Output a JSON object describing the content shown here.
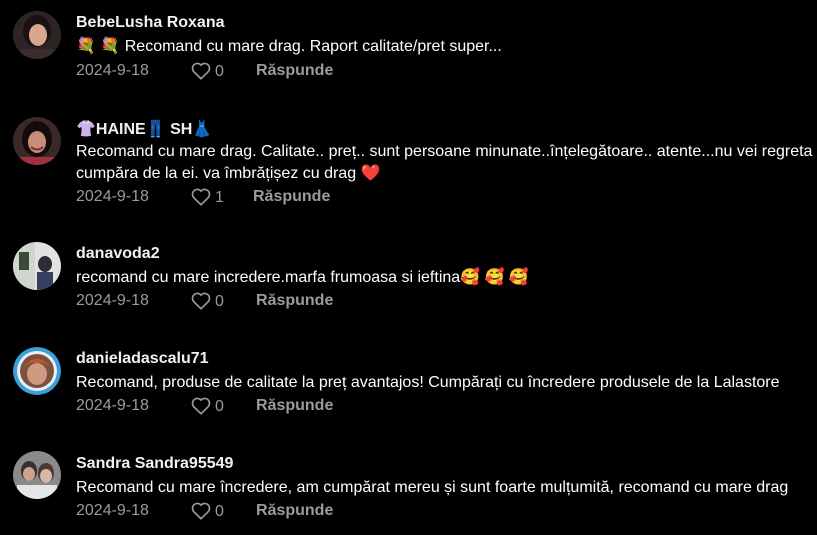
{
  "comments": [
    {
      "username": "BebeLusha Roxana",
      "text": "💐 💐 Recomand cu mare drag. Raport calitate/pret super...",
      "text2": "",
      "date": "2024-9-18",
      "likes": "0",
      "reply_label": "Răspunde",
      "avatar_colors": [
        "#3a2a2a",
        "#d9a58c"
      ]
    },
    {
      "username": "👚HAINE👖 SH👗",
      "text": "Recomand cu mare drag. Calitate.. preț.. sunt persoane minunate..înțelegătoare.. atente...nu vei regreta daca",
      "text2": "cumpăra de la ei. va îmbrățișez cu drag ❤️",
      "date": "2024-9-18",
      "likes": "1",
      "reply_label": "Răspunde",
      "avatar_colors": [
        "#2a1c1c",
        "#b88473"
      ]
    },
    {
      "username": "danavoda2",
      "text": "recomand cu mare incredere.marfa frumoasa si ieftina🥰 🥰 🥰",
      "text2": "",
      "date": "2024-9-18",
      "likes": "0",
      "reply_label": "Răspunde",
      "avatar_colors": [
        "#d8d8d8",
        "#2f3a4a"
      ]
    },
    {
      "username": "danieladascalu71",
      "text": "Recomand, produse de calitate la preț avantajos! Cumpărați cu încredere produsele de la Lalastore",
      "text2": "",
      "date": "2024-9-18",
      "likes": "0",
      "reply_label": "Răspunde",
      "avatar_colors": [
        "#3aa0d8",
        "#c4734a"
      ]
    },
    {
      "username": "Sandra Sandra95549",
      "text": "Recomand cu mare încredere, am cumpărat mereu și sunt foarte mulțumită, recomand cu mare drag",
      "text2": "",
      "date": "2024-9-18",
      "likes": "0",
      "reply_label": "Răspunde",
      "avatar_colors": [
        "#5a5050",
        "#c9b6a8"
      ]
    }
  ]
}
